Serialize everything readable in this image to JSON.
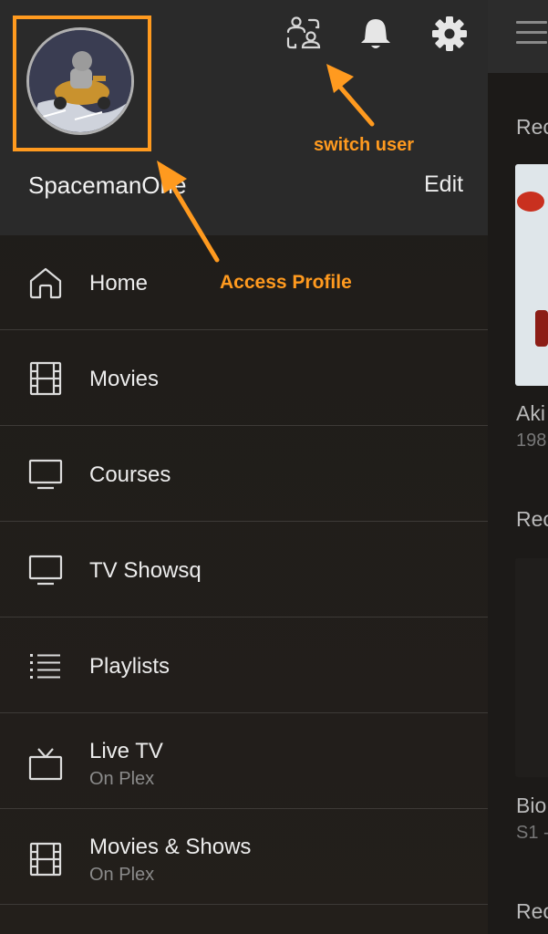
{
  "background_app": {
    "rows": [
      {
        "title": "Rec"
      },
      {
        "title": "Aki",
        "subtitle": "198"
      },
      {
        "title": "Rec"
      },
      {
        "title": "Bio",
        "subtitle": "S1 -"
      },
      {
        "title": "Rec"
      }
    ]
  },
  "header": {
    "username": "SpacemanOne",
    "edit_label": "Edit"
  },
  "menu": [
    {
      "label": "Home",
      "icon": "home-icon"
    },
    {
      "label": "Movies",
      "icon": "film-icon"
    },
    {
      "label": "Courses",
      "icon": "monitor-icon"
    },
    {
      "label": "TV Showsq",
      "icon": "monitor-icon"
    },
    {
      "label": "Playlists",
      "icon": "list-icon"
    },
    {
      "label": "Live TV",
      "sublabel": "On Plex",
      "icon": "tv-antenna-icon"
    },
    {
      "label": "Movies & Shows",
      "sublabel": "On Plex",
      "icon": "film-icon"
    }
  ],
  "annotations": {
    "switch_user": "switch user",
    "access_profile": "Access Profile"
  },
  "colors": {
    "annotation": "#ff9a1f",
    "header_bg": "#2a2a2a",
    "drawer_bg": "#1e1c1a"
  }
}
